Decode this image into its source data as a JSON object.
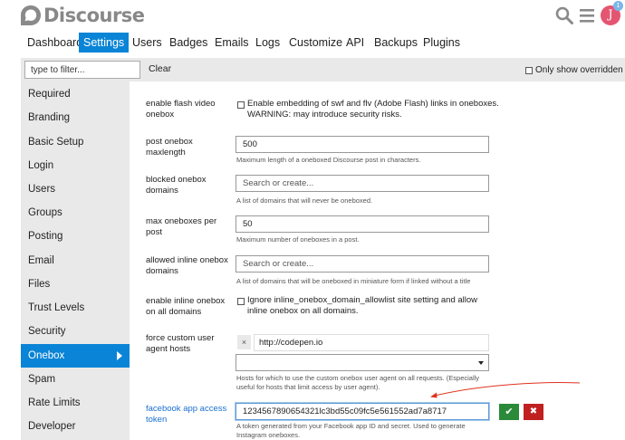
{
  "header": {
    "logo_text": "Discourse",
    "icons": [
      "search-icon",
      "hamburger-menu-icon"
    ],
    "avatar_letter": "J",
    "notification_count": "1",
    "colors": {
      "avatar": "#e45571",
      "notification": "#7db6e8",
      "logo": "#888888"
    }
  },
  "nav": {
    "tabs": [
      {
        "label": "Dashboard"
      },
      {
        "label": "Settings"
      },
      {
        "label": "Users"
      },
      {
        "label": "Badges"
      },
      {
        "label": "Emails"
      },
      {
        "label": "Logs"
      },
      {
        "label": "Customize"
      },
      {
        "label": "API"
      },
      {
        "label": "Backups"
      },
      {
        "label": "Plugins"
      }
    ],
    "active": "Settings",
    "accent_color": "#0a84d6"
  },
  "filter": {
    "placeholder": "type to filter...",
    "clear_label": "Clear",
    "only_overridden_label": "Only show overridden"
  },
  "sidebar": {
    "items": [
      {
        "label": "Required"
      },
      {
        "label": "Branding"
      },
      {
        "label": "Basic Setup"
      },
      {
        "label": "Login"
      },
      {
        "label": "Users"
      },
      {
        "label": "Groups"
      },
      {
        "label": "Posting"
      },
      {
        "label": "Email"
      },
      {
        "label": "Files"
      },
      {
        "label": "Trust Levels"
      },
      {
        "label": "Security"
      },
      {
        "label": "Onebox"
      },
      {
        "label": "Spam"
      },
      {
        "label": "Rate Limits"
      },
      {
        "label": "Developer"
      }
    ],
    "active": "Onebox"
  },
  "settings": {
    "flash_video": {
      "label": "enable flash video onebox",
      "checkbox_text": "Enable embedding of swf and flv (Adobe Flash) links in oneboxes. WARNING: may introduce security risks."
    },
    "maxlength": {
      "label": "post onebox maxlength",
      "value": "500",
      "description": "Maximum length of a oneboxed Discourse post in characters."
    },
    "blocked_domains": {
      "label": "blocked onebox domains",
      "placeholder": "Search or create...",
      "description": "A list of domains that will never be oneboxed."
    },
    "max_oneboxes": {
      "label": "max oneboxes per post",
      "value": "50",
      "description": "Maximum number of oneboxes in a post."
    },
    "inline_domains": {
      "label": "allowed inline onebox domains",
      "placeholder": "Search or create...",
      "description": "A list of domains that will be oneboxed in miniature form if linked without a title"
    },
    "inline_all": {
      "label": "enable inline onebox on all domains",
      "checkbox_text": "Ignore inline_onebox_domain_allowlist site setting and allow inline onebox on all domains."
    },
    "custom_agent": {
      "label": "force custom user agent hosts",
      "list_value": "http://codepen.io",
      "remove_symbol": "×",
      "description": "Hosts for which to use the custom onebox user agent on all requests. (Especially useful for hosts that limit access by user agent)."
    },
    "facebook_token": {
      "label": "facebook app access token",
      "value": "1234567890654321lc3bd55c09fc5e561552ad7a8717",
      "description": "A token generated from your Facebook app ID and secret. Used to generate Instagram oneboxes.",
      "ok_symbol": "✔",
      "cancel_symbol": "✖",
      "colors": {
        "ok": "#2a8a3a",
        "cancel": "#c02020",
        "label": "#1a6fd1"
      }
    }
  },
  "annotation": {
    "arrow_color": "#e0321e"
  }
}
